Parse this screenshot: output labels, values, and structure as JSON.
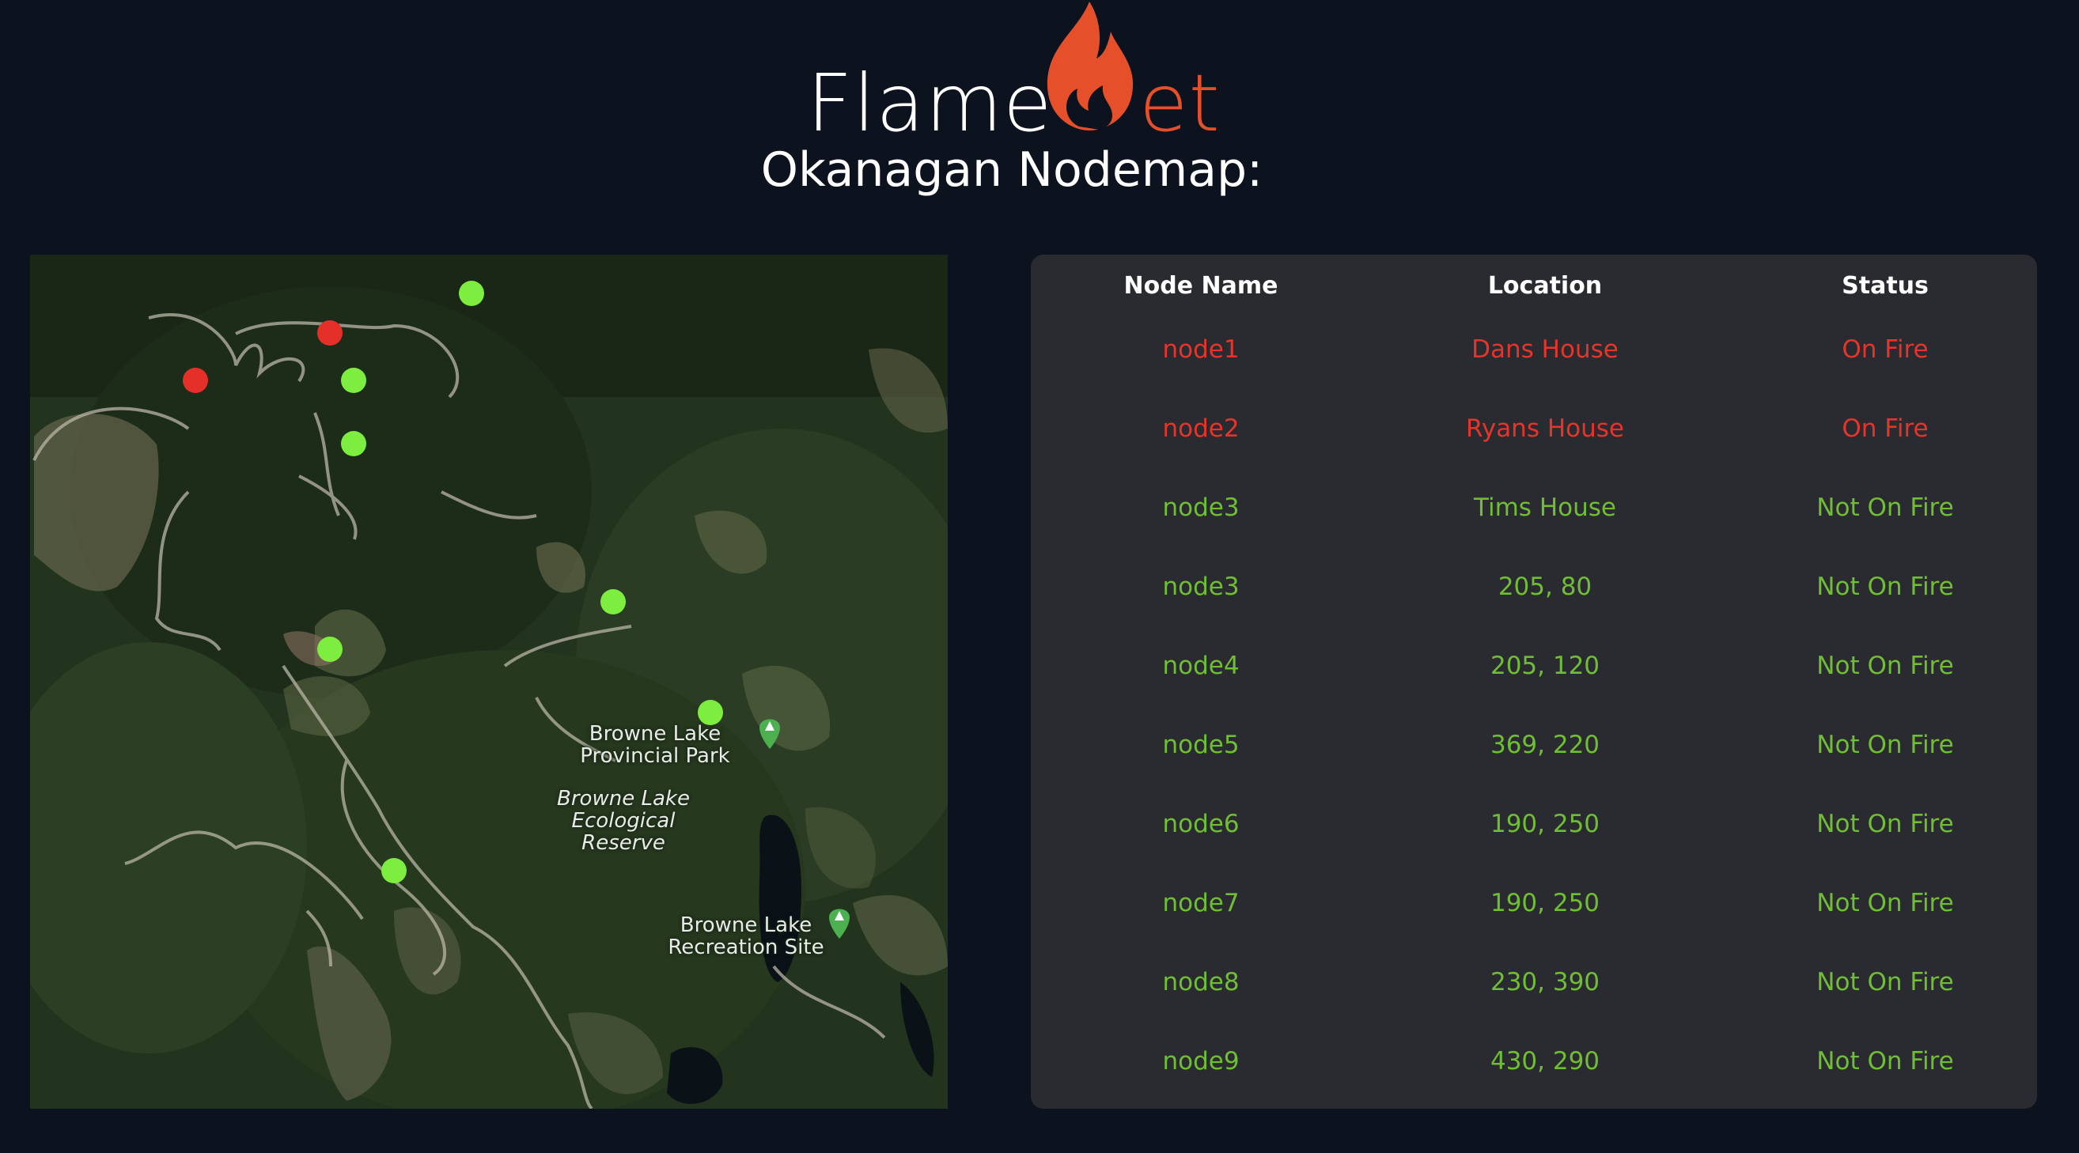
{
  "header": {
    "logo_left": "Flame",
    "logo_right": "et",
    "title": "Okanagan Nodemap:"
  },
  "colors": {
    "background": "#0c131f",
    "panel": "#2a2b30",
    "brand": "#e5502a",
    "fire": "#e5352a",
    "ok": "#6fbe34",
    "dot_fire": "#e5302a",
    "dot_ok": "#7ded3f"
  },
  "map": {
    "labels": [
      {
        "line1": "Browne Lake",
        "line2": "Provincial Park"
      },
      {
        "line1": "Browne Lake",
        "line2": "Ecological",
        "line3": "Reserve"
      },
      {
        "line1": "Browne Lake",
        "line2": "Recreation Site"
      }
    ],
    "markers": [
      {
        "status": "fire"
      },
      {
        "status": "fire"
      },
      {
        "status": "ok"
      },
      {
        "status": "ok"
      },
      {
        "status": "ok"
      },
      {
        "status": "ok"
      },
      {
        "status": "ok"
      },
      {
        "status": "ok"
      },
      {
        "status": "ok"
      }
    ]
  },
  "table": {
    "columns": [
      "Node Name",
      "Location",
      "Status"
    ],
    "rows": [
      {
        "name": "node1",
        "location": "Dans House",
        "status": "On Fire",
        "state": "fire"
      },
      {
        "name": "node2",
        "location": "Ryans House",
        "status": "On Fire",
        "state": "fire"
      },
      {
        "name": "node3",
        "location": "Tims House",
        "status": "Not On Fire",
        "state": "ok"
      },
      {
        "name": "node3",
        "location": "205, 80",
        "status": "Not On Fire",
        "state": "ok"
      },
      {
        "name": "node4",
        "location": "205, 120",
        "status": "Not On Fire",
        "state": "ok"
      },
      {
        "name": "node5",
        "location": "369, 220",
        "status": "Not On Fire",
        "state": "ok"
      },
      {
        "name": "node6",
        "location": "190, 250",
        "status": "Not On Fire",
        "state": "ok"
      },
      {
        "name": "node7",
        "location": "190, 250",
        "status": "Not On Fire",
        "state": "ok"
      },
      {
        "name": "node8",
        "location": "230, 390",
        "status": "Not On Fire",
        "state": "ok"
      },
      {
        "name": "node9",
        "location": "430, 290",
        "status": "Not On Fire",
        "state": "ok"
      }
    ]
  }
}
